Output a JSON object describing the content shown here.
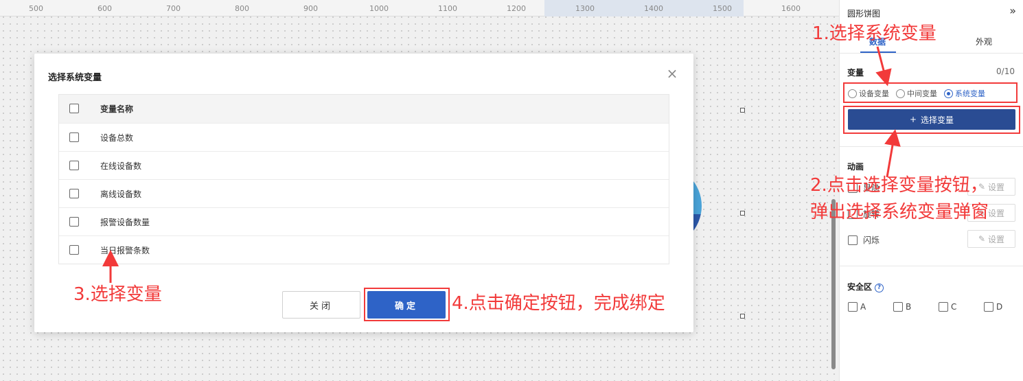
{
  "ruler": {
    "ticks": [
      "500",
      "600",
      "700",
      "800",
      "900",
      "1000",
      "1100",
      "1200",
      "1300",
      "1400",
      "1500",
      "1600"
    ]
  },
  "modal": {
    "title": "选择系统变量",
    "close_icon": "×",
    "table": {
      "header": "变量名称",
      "rows": [
        "设备总数",
        "在线设备数",
        "离线设备数",
        "报警设备数量",
        "当日报警条数"
      ]
    },
    "close_button": "关闭",
    "ok_button": "确定"
  },
  "panel": {
    "title": "圆形饼图",
    "collapse_icon": "»",
    "tabs": [
      "数据",
      "外观"
    ],
    "variable": {
      "label": "变量",
      "count": "0/10",
      "radio_options": [
        "设备变量",
        "中间变量",
        "系统变量"
      ],
      "selected": "系统变量",
      "select_button": "选择变量",
      "select_button_icon": "+"
    },
    "animation": {
      "label": "动画",
      "items": [
        "显隐",
        "旋转",
        "闪烁"
      ],
      "set_button": "设置",
      "set_icon": "✎"
    },
    "safe_zone": {
      "label": "安全区",
      "help_icon": "?",
      "options": [
        "A",
        "B",
        "C",
        "D"
      ]
    }
  },
  "annotations": {
    "step1": "1.选择系统变量",
    "step2_line1": "2.点击选择变量按钮，",
    "step2_line2": "弹出选择系统变量弹窗",
    "step3": "3.选择变量",
    "step4": "4.点击确定按钮，完成绑定"
  },
  "colors": {
    "accent": "#2e63c7",
    "annotation": "#f23a3a",
    "select_button": "#2a4c93"
  }
}
